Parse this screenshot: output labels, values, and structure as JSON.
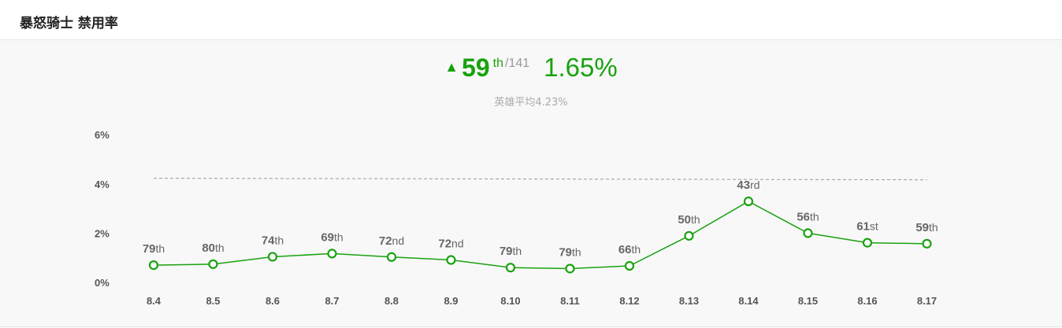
{
  "header": {
    "title": "暴怒骑士 禁用率"
  },
  "summary": {
    "arrow": "▲",
    "rank": "59",
    "rank_suffix": "th",
    "total": "/141",
    "rate": "1.65%",
    "average_label": "英雄平均4.23%"
  },
  "colors": {
    "accent": "#19a20f",
    "average_line": "#999999",
    "background": "#f8f8f8"
  },
  "chart_data": {
    "type": "line",
    "categories": [
      "8.4",
      "8.5",
      "8.6",
      "8.7",
      "8.8",
      "8.9",
      "8.10",
      "8.11",
      "8.12",
      "8.13",
      "8.14",
      "8.15",
      "8.16",
      "8.17"
    ],
    "values": [
      0.7,
      0.74,
      1.04,
      1.17,
      1.03,
      0.91,
      0.6,
      0.56,
      0.67,
      1.89,
      3.29,
      2.0,
      1.61,
      1.57
    ],
    "rank_labels": [
      [
        "79",
        "th"
      ],
      [
        "80",
        "th"
      ],
      [
        "74",
        "th"
      ],
      [
        "69",
        "th"
      ],
      [
        "72",
        "nd"
      ],
      [
        "72",
        "nd"
      ],
      [
        "79",
        "th"
      ],
      [
        "79",
        "th"
      ],
      [
        "66",
        "th"
      ],
      [
        "50",
        "th"
      ],
      [
        "43",
        "rd"
      ],
      [
        "56",
        "th"
      ],
      [
        "61",
        "st"
      ],
      [
        "59",
        "th"
      ]
    ],
    "average": 4.23,
    "ylim": [
      0,
      6
    ],
    "yticks": [
      "0%",
      "2%",
      "4%",
      "6%"
    ],
    "ytick_values": [
      0,
      2,
      4,
      6
    ],
    "title": "",
    "xlabel": "",
    "ylabel": "",
    "grid": false,
    "legend": "none"
  }
}
